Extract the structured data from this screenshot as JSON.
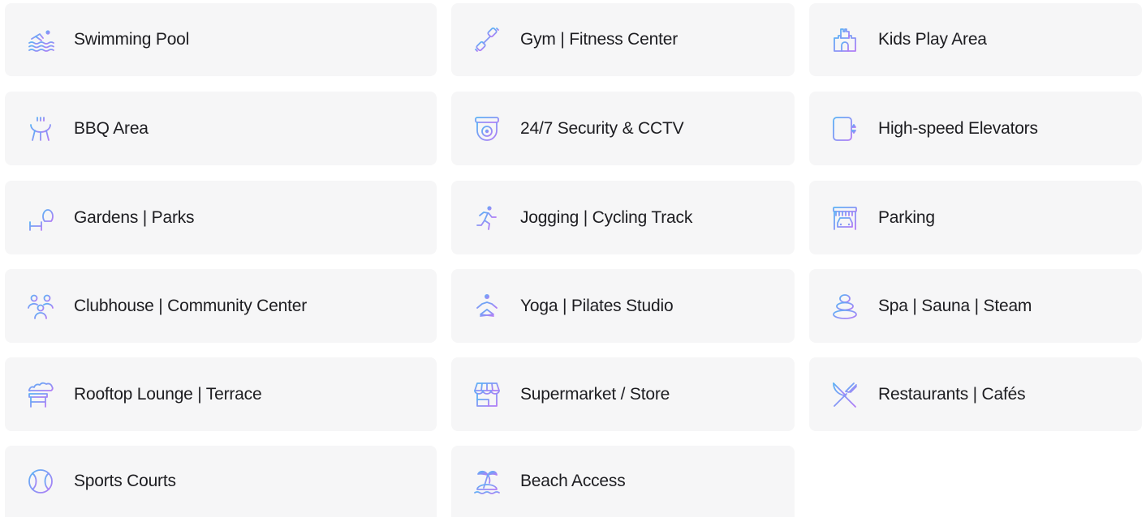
{
  "colors": {
    "card_background": "#f6f6f7",
    "text": "#1d1d21",
    "icon_gradient_start": "#5ab2f5",
    "icon_gradient_end": "#b27cf6"
  },
  "amenities": [
    {
      "label": "Swimming Pool",
      "icon": "swimming-pool-icon"
    },
    {
      "label": "Gym | Fitness Center",
      "icon": "dumbbell-icon"
    },
    {
      "label": "Kids Play Area",
      "icon": "castle-icon"
    },
    {
      "label": "BBQ Area",
      "icon": "bbq-grill-icon"
    },
    {
      "label": "24/7 Security & CCTV",
      "icon": "cctv-camera-icon"
    },
    {
      "label": "High-speed Elevators",
      "icon": "elevator-icon"
    },
    {
      "label": "Gardens | Parks",
      "icon": "park-bench-tree-icon"
    },
    {
      "label": "Jogging | Cycling Track",
      "icon": "runner-icon"
    },
    {
      "label": "Parking",
      "icon": "parking-garage-icon"
    },
    {
      "label": "Clubhouse | Community Center",
      "icon": "community-people-icon"
    },
    {
      "label": "Yoga | Pilates Studio",
      "icon": "yoga-icon"
    },
    {
      "label": "Spa | Sauna | Steam",
      "icon": "spa-stones-icon"
    },
    {
      "label": "Rooftop Lounge | Terrace",
      "icon": "rooftop-lounge-icon"
    },
    {
      "label": "Supermarket / Store",
      "icon": "store-icon"
    },
    {
      "label": "Restaurants | Cafés",
      "icon": "fork-knife-icon"
    },
    {
      "label": "Sports Courts",
      "icon": "tennis-ball-icon"
    },
    {
      "label": "Beach Access",
      "icon": "palm-island-icon"
    }
  ]
}
